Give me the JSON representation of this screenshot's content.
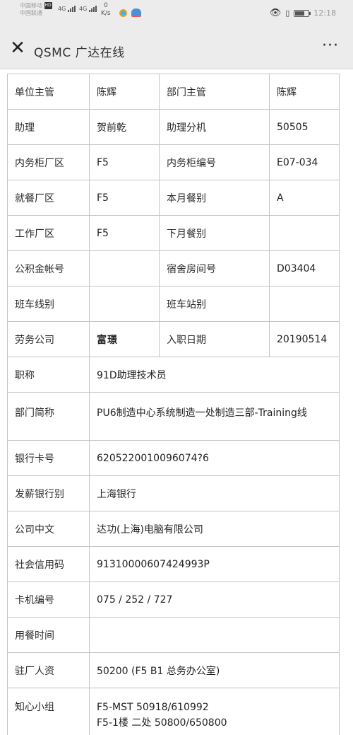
{
  "status_bar": {
    "carrier1": "中国移动",
    "badge": "HD",
    "carrier2": "中国联通",
    "net1": "4G",
    "net2": "4G",
    "speed_value": "0",
    "speed_unit": "K/s",
    "time": "12:18",
    "icons": [
      "eye-icon",
      "vibrate-icon",
      "battery-icon"
    ]
  },
  "title_bar": {
    "close_glyph": "✕",
    "title": "QSMC 广达在线",
    "more_glyph": "···"
  },
  "rows": [
    {
      "l1": "单位主管",
      "v1": "陈辉",
      "l2": "部门主管",
      "v2": "陈辉"
    },
    {
      "l1": "助理",
      "v1": "贺前乾",
      "l2": "助理分机",
      "v2": "50505"
    },
    {
      "l1": "内务柜厂区",
      "v1": "F5",
      "l2": "内务柜编号",
      "v2": "E07-034"
    },
    {
      "l1": "就餐厂区",
      "v1": "F5",
      "l2": "本月餐别",
      "v2": "A"
    },
    {
      "l1": "工作厂区",
      "v1": "F5",
      "l2": "下月餐别",
      "v2": ""
    },
    {
      "l1": "公积金帐号",
      "v1": "",
      "l2": "宿舍房间号",
      "v2": "D03404"
    },
    {
      "l1": "班车线别",
      "v1": "",
      "l2": "班车站别",
      "v2": ""
    },
    {
      "l1": "劳务公司",
      "v1": "富璟",
      "l2": "入职日期",
      "v2": "20190514"
    }
  ],
  "wide_rows": [
    {
      "label": "职称",
      "value": "91D助理技术员"
    },
    {
      "label": "部门简称",
      "value": "PU6制造中心系统制造一处制造三部-Training线"
    },
    {
      "label": "银行卡号",
      "value": "6205220010096074?6"
    },
    {
      "label": "发薪银行别",
      "value": "上海银行"
    },
    {
      "label": "公司中文",
      "value": "达功(上海)电脑有限公司"
    },
    {
      "label": "社会信用码",
      "value": "91310000607424993P"
    },
    {
      "label": "卡机编号",
      "value": "075 / 252 / 727"
    },
    {
      "label": "用餐时间",
      "value": ""
    },
    {
      "label": "驻厂人资",
      "value": "50200 (F5 B1 总务办公室)"
    },
    {
      "label": "知心小组",
      "value": "F5-MST 50918/610992",
      "value2": "F5-1楼 二处 50800/650800"
    }
  ]
}
